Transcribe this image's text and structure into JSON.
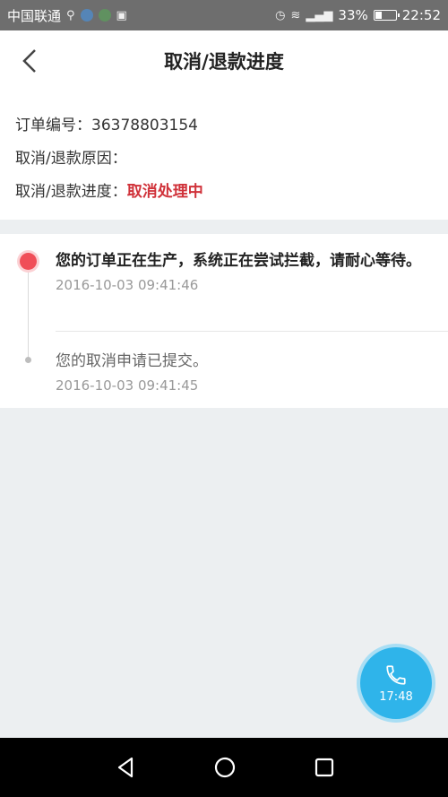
{
  "statusbar": {
    "carrier": "中国联通",
    "battery": "33%",
    "time": "22:52",
    "battery_level": 0.33
  },
  "header": {
    "title": "取消/退款进度"
  },
  "info": {
    "order_label": "订单编号：",
    "order_value": "36378803154",
    "reason_label": "取消/退款原因：",
    "reason_value": "",
    "progress_label": "取消/退款进度：",
    "progress_value": "取消处理中"
  },
  "timeline": [
    {
      "text": "您的订单正在生产，系统正在尝试拦截，请耐心等待。",
      "time": "2016-10-03 09:41:46"
    },
    {
      "text": "您的取消申请已提交。",
      "time": "2016-10-03 09:41:45"
    }
  ],
  "call": {
    "time": "17:48"
  },
  "colors": {
    "accent_red": "#d0323a",
    "call_blue": "#2fb4ea",
    "statusbar_gray": "#6e6e6e"
  },
  "icons": {
    "back": "chevron-left-icon",
    "phone": "phone-icon",
    "nav_back": "triangle-back-icon",
    "nav_home": "circle-home-icon",
    "nav_recent": "square-recent-icon"
  }
}
